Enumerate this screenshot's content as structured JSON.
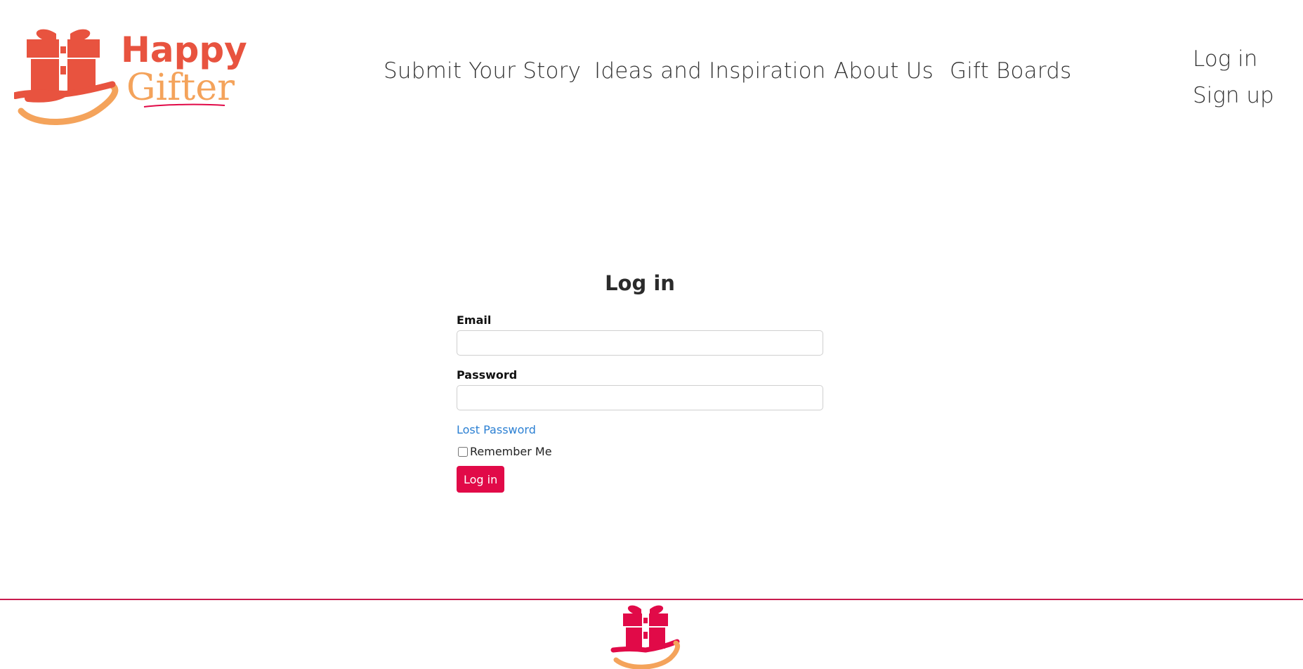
{
  "brand": {
    "name_line1": "Happy",
    "name_line2": "Gifter"
  },
  "nav": {
    "items": [
      {
        "label": "Submit Your Story"
      },
      {
        "label": "Ideas and Inspiration"
      },
      {
        "label": "About Us"
      },
      {
        "label": "Gift Boards"
      }
    ]
  },
  "auth": {
    "login_label": "Log in",
    "signup_label": "Sign up"
  },
  "login_form": {
    "title": "Log in",
    "email_label": "Email",
    "email_value": "",
    "password_label": "Password",
    "password_value": "",
    "lost_password_label": "Lost Password",
    "remember_label": "Remember Me",
    "remember_checked": false,
    "submit_label": "Log in"
  },
  "colors": {
    "brand_red": "#e8533f",
    "brand_orange": "#f4a35b",
    "accent_crimson": "#e10a48",
    "link_blue": "#2c80d3"
  }
}
